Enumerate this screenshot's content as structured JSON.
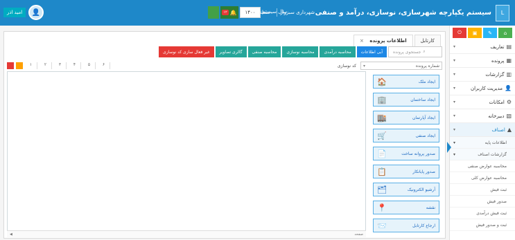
{
  "header": {
    "app_title": "سیستم یکپارچه شهرسازی، نوسازی، درآمد و صنفی",
    "crumbs": [
      "شهرداری سبزوار",
      "منطقه یک",
      "سال سیستم"
    ],
    "year_value": "۱۴۰۰",
    "alert_badge": "۱۲",
    "user_name": "امید اذر",
    "logo_text": "L"
  },
  "tabs": [
    {
      "label": "اطلاعات پرونده",
      "close": "×"
    },
    {
      "label": "کارتابل",
      "close": ""
    }
  ],
  "toolbar": {
    "search_placeholder": "جستجوی پرونده",
    "buttons": [
      {
        "label": "آبی اطلاعات",
        "color": "#1e88e5"
      },
      {
        "label": "محاسبه درآمدی",
        "color": "#26a69a"
      },
      {
        "label": "محاسبه نوسازی",
        "color": "#26a69a"
      },
      {
        "label": "محاسبه صنفی",
        "color": "#26a69a"
      },
      {
        "label": "گالری تصاویر",
        "color": "#26a69a"
      },
      {
        "label": "غیر فعال سازی کد نوسازی",
        "color": "#e53935"
      }
    ]
  },
  "filter": {
    "select_label": "شماره پرونده",
    "grid_label": "کد نوسازی",
    "pager": [
      "۱",
      "۲",
      "۳",
      "۴",
      "۵",
      "۶"
    ]
  },
  "actions": [
    {
      "label": "ایجاد ملک",
      "icon": "house-icon",
      "glyph": "🏠"
    },
    {
      "label": "ایجاد ساختمان",
      "icon": "building-icon",
      "glyph": "🏢"
    },
    {
      "label": "ایجاد آپارتمان",
      "icon": "apartment-icon",
      "glyph": "🏬"
    },
    {
      "label": "ایجاد صنفی",
      "icon": "shop-icon",
      "glyph": "🛒"
    },
    {
      "label": "صدور پروانه ساخت",
      "icon": "permit-icon",
      "glyph": "📄"
    },
    {
      "label": "صدور پایانکار",
      "icon": "certificate-icon",
      "glyph": "📋"
    },
    {
      "label": "آرشیو الکترونیک",
      "icon": "archive-icon",
      "glyph": "🗂"
    },
    {
      "label": "نقشه",
      "icon": "map-pin-icon",
      "glyph": "📍"
    },
    {
      "label": "ارجاع کارتابل",
      "icon": "forward-icon",
      "glyph": "📨"
    }
  ],
  "grid_footer": {
    "left": "◀",
    "right": "صفحه"
  },
  "sidebar": {
    "top_icons": [
      {
        "name": "home-icon",
        "color": "#4caf50",
        "glyph": "⌂"
      },
      {
        "name": "edit-icon",
        "color": "#29b6f6",
        "glyph": "✎"
      },
      {
        "name": "folder-icon",
        "color": "#ffb300",
        "glyph": "▣"
      },
      {
        "name": "power-icon",
        "color": "#e53935",
        "glyph": "⏻"
      }
    ],
    "items": [
      {
        "label": "تعاریف",
        "icon": "definitions-icon",
        "glyph": "▤"
      },
      {
        "label": "پرونده",
        "icon": "file-icon",
        "glyph": "▦"
      },
      {
        "label": "گزارشات",
        "icon": "reports-icon",
        "glyph": "▥"
      },
      {
        "label": "مدیریت کاربران",
        "icon": "users-icon",
        "glyph": "👤"
      },
      {
        "label": "امکانات",
        "icon": "settings-icon",
        "glyph": "⚙"
      },
      {
        "label": "دبیرخانه",
        "icon": "secretariat-icon",
        "glyph": "▧"
      },
      {
        "label": "اصناف",
        "icon": "guild-icon",
        "glyph": "▲"
      }
    ],
    "subitems": [
      {
        "label": "اطلاعات پایه"
      },
      {
        "label": "گزارشات اصناف"
      },
      {
        "label": "محاسبه عوارض صنفی"
      },
      {
        "label": "محاسبه عوارض کلی"
      },
      {
        "label": "ثبت فیش"
      },
      {
        "label": "صدور فیش"
      },
      {
        "label": "ثبت فیش درآمدی"
      },
      {
        "label": "ثبت و صدور فیش"
      }
    ]
  }
}
